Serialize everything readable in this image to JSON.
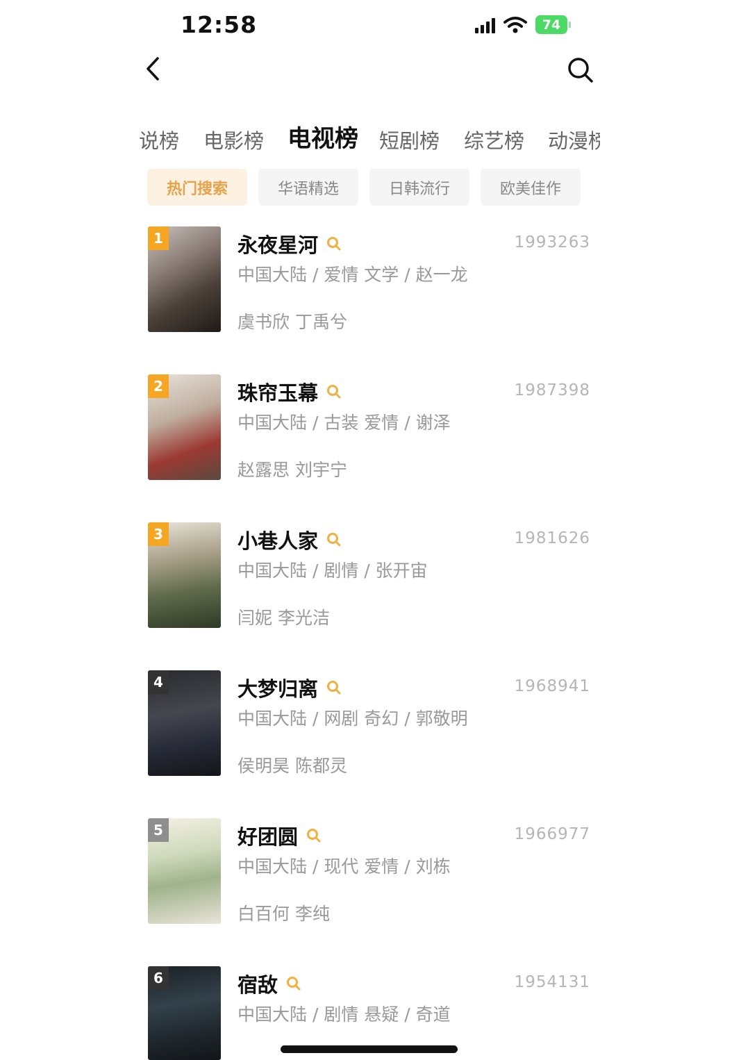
{
  "status": {
    "time": "12:58",
    "battery": "74"
  },
  "tabs": [
    {
      "label": "说榜",
      "active": false
    },
    {
      "label": "电影榜",
      "active": false
    },
    {
      "label": "电视榜",
      "active": true
    },
    {
      "label": "短剧榜",
      "active": false
    },
    {
      "label": "综艺榜",
      "active": false
    },
    {
      "label": "动漫榜",
      "active": false
    }
  ],
  "chips": [
    {
      "label": "热门搜索",
      "active": true
    },
    {
      "label": "华语精选",
      "active": false
    },
    {
      "label": "日韩流行",
      "active": false
    },
    {
      "label": "欧美佳作",
      "active": false
    }
  ],
  "items": [
    {
      "rank": "1",
      "title": "永夜星河",
      "score": "1993263",
      "meta": "中国大陆 / 爱情 文学 / 赵一龙",
      "cast": "虞书欣 丁禹兮"
    },
    {
      "rank": "2",
      "title": "珠帘玉幕",
      "score": "1987398",
      "meta": "中国大陆 / 古装 爱情 / 谢泽",
      "cast": "赵露思 刘宇宁"
    },
    {
      "rank": "3",
      "title": "小巷人家",
      "score": "1981626",
      "meta": "中国大陆 / 剧情 / 张开宙",
      "cast": "闫妮 李光洁"
    },
    {
      "rank": "4",
      "title": "大梦归离",
      "score": "1968941",
      "meta": "中国大陆 / 网剧 奇幻 / 郭敬明",
      "cast": "侯明昊 陈都灵"
    },
    {
      "rank": "5",
      "title": "好团圆",
      "score": "1966977",
      "meta": "中国大陆 / 现代 爱情 / 刘栋",
      "cast": "白百何 李纯"
    },
    {
      "rank": "6",
      "title": "宿敌",
      "score": "1954131",
      "meta": "中国大陆 / 剧情 悬疑 / 奇道",
      "cast": ""
    }
  ],
  "colors": {
    "accent": "#e8a24a",
    "rank_orange": "#f5a623",
    "rank_dark": "#333333",
    "rank_gray": "#8e8e8e"
  }
}
